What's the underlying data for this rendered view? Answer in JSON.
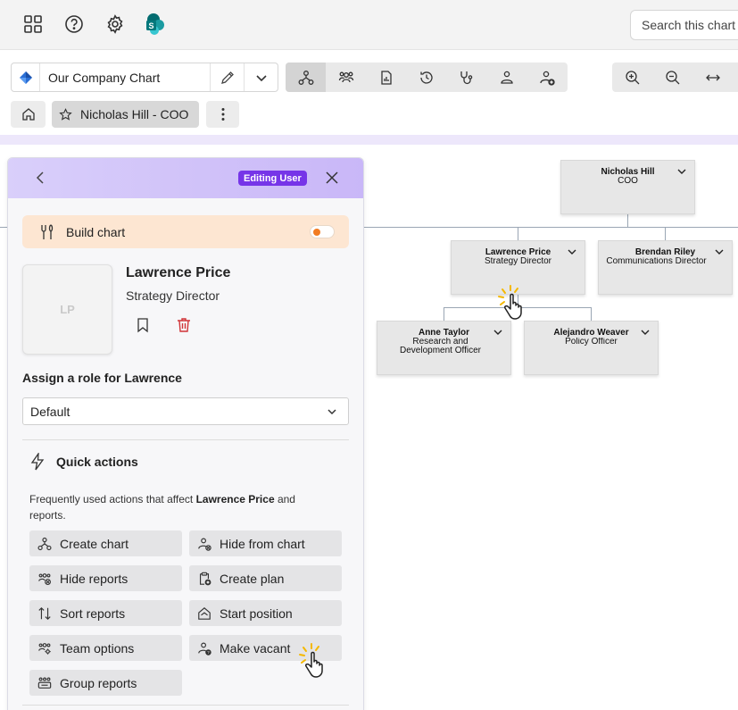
{
  "topbar": {
    "icons": [
      "apps-grid-icon",
      "help-icon",
      "settings-gear-icon",
      "sharepoint-logo-icon"
    ],
    "search_placeholder": "Search this chart"
  },
  "toolbar": {
    "chart_name": "Our Company Chart",
    "views": [
      "org-chart-view-icon",
      "team-view-icon",
      "report-view-icon",
      "history-view-icon",
      "health-check-icon",
      "people-view-icon",
      "add-person-icon"
    ],
    "zoom": [
      "zoom-in-icon",
      "zoom-out-icon",
      "fit-width-icon"
    ]
  },
  "breadcrumb": {
    "current": "Nicholas Hill - COO"
  },
  "chart": {
    "nodes": [
      {
        "name": "Nicholas Hill",
        "title": "COO"
      },
      {
        "name": "Lawrence Price",
        "title": "Strategy Director"
      },
      {
        "name": "Brendan Riley",
        "title": "Communications Director"
      },
      {
        "name": "Anne Taylor",
        "title": "Research and Development Officer"
      },
      {
        "name": "Alejandro Weaver",
        "title": "Policy Officer"
      }
    ]
  },
  "panel": {
    "badge": "Editing User",
    "build_chart_label": "Build chart",
    "build_chart_enabled": true,
    "avatar_initials": "LP",
    "user_name": "Lawrence Price",
    "user_title": "Strategy Director",
    "role_label": "Assign a role for Lawrence",
    "role_value": "Default",
    "quick_actions_title": "Quick actions",
    "quick_actions_desc_prefix": "Frequently used actions that affect ",
    "quick_actions_desc_name": "Lawrence Price",
    "quick_actions_desc_suffix": " and reports.",
    "actions": [
      {
        "label": "Create chart",
        "icon": "create-chart-icon"
      },
      {
        "label": "Hide from chart",
        "icon": "hide-person-icon"
      },
      {
        "label": "Hide reports",
        "icon": "hide-reports-icon"
      },
      {
        "label": "Create plan",
        "icon": "create-plan-icon"
      },
      {
        "label": "Sort reports",
        "icon": "sort-icon"
      },
      {
        "label": "Start position",
        "icon": "start-position-icon"
      },
      {
        "label": "Team options",
        "icon": "team-options-icon"
      },
      {
        "label": "Make vacant",
        "icon": "make-vacant-icon"
      },
      {
        "label": "Group reports",
        "icon": "group-reports-icon"
      }
    ]
  },
  "colors": {
    "accent_purple": "#7635e8",
    "header_lavender": "#d9cffa",
    "build_chart_bg": "#fde6d2",
    "toggle_knob": "#f27c22",
    "delete_red": "#d13438",
    "node_bg": "#e7e7e7"
  }
}
